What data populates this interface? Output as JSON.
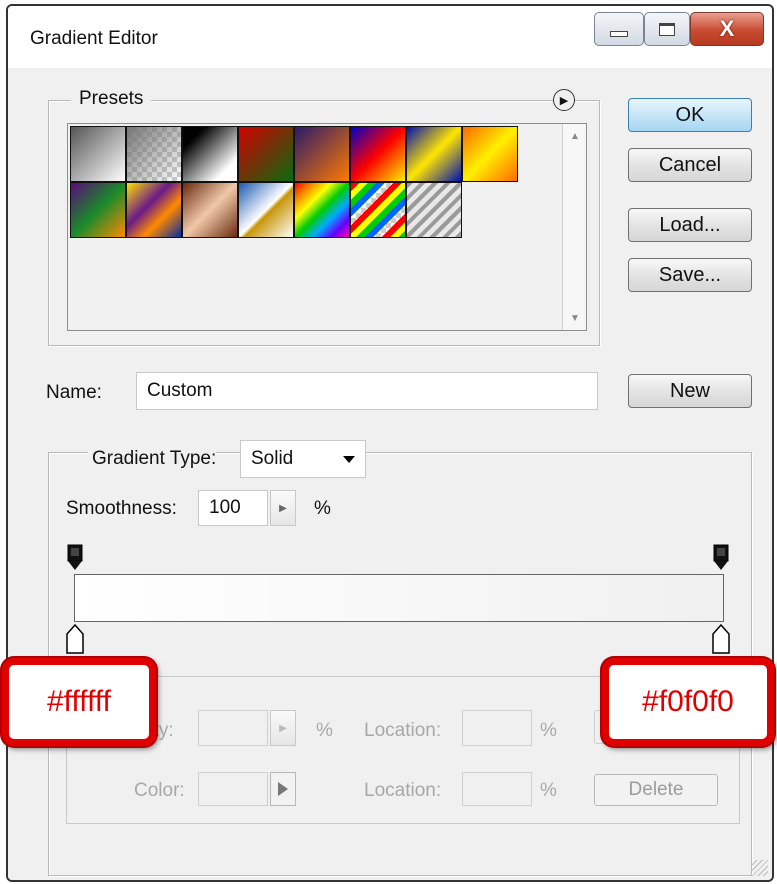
{
  "window": {
    "title": "Gradient Editor",
    "close_glyph": "X"
  },
  "presets": {
    "label": "Presets",
    "swatches": [
      {
        "name": "foreground-to-background",
        "css": "linear-gradient(135deg,#555,#fff)"
      },
      {
        "name": "foreground-to-transparent",
        "css": "linear-gradient(135deg,#777,rgba(255,255,255,0)),repeating-conic-gradient(#ccc 0 25%,#fff 0 50%) 0 0/10px 10px"
      },
      {
        "name": "black-white",
        "css": "linear-gradient(135deg,#000 20%,#fff 80%)"
      },
      {
        "name": "red-green",
        "css": "linear-gradient(135deg,#d10000,#0a6a10)"
      },
      {
        "name": "violet-orange",
        "css": "linear-gradient(135deg,#2a1a6a,#ff7a00)"
      },
      {
        "name": "blue-red-yellow",
        "css": "linear-gradient(135deg,#0000c8,#ff0000 50%,#ffee00)"
      },
      {
        "name": "blue-yellow-blue",
        "css": "linear-gradient(135deg,#0010b0,#ffe600 50%,#0010b0)"
      },
      {
        "name": "orange-yellow-orange",
        "css": "linear-gradient(135deg,#ff6a00,#fff000 50%,#ff6a00)"
      },
      {
        "name": "violet-green-orange",
        "css": "linear-gradient(135deg,#5a0a7a,#1a8a2a 50%,#ff8a00)"
      },
      {
        "name": "yellow-violet-orange-blue",
        "css": "linear-gradient(135deg,#ffe000,#6a1a8a 40%,#ff8a00 65%,#0a2aa0)"
      },
      {
        "name": "copper",
        "css": "linear-gradient(135deg,#6a2a10,#f0c8a8 50%,#6a2a10)"
      },
      {
        "name": "chrome",
        "css": "linear-gradient(135deg,#1a5ab0,#ffffff 50%,#c8960a 55%,#fff)"
      },
      {
        "name": "spectrum",
        "css": "linear-gradient(135deg,#ff0000,#ff8800,#ffff00,#00cc00,#00aaff,#6600ff,#ff00aa)"
      },
      {
        "name": "transparent-rainbow",
        "css": "repeating-linear-gradient(135deg,#ff0000 0 6px,#ffff00 6px 12px,#00cc00 12px 18px,#0066ff 18px 24px,transparent 24px 30px),repeating-conic-gradient(#ccc 0 25%,#fff 0 50%) 0 0/10px 10px"
      },
      {
        "name": "transparent-stripes",
        "css": "repeating-linear-gradient(135deg,#9a9a9a 0 4px,#e8e8e8 4px 9px)"
      }
    ]
  },
  "buttons": {
    "ok": "OK",
    "cancel": "Cancel",
    "load": "Load...",
    "save": "Save...",
    "new": "New",
    "delete": "Delete"
  },
  "name": {
    "label": "Name:",
    "value": "Custom"
  },
  "gradient": {
    "type_label": "Gradient Type:",
    "type_value": "Solid",
    "smoothness_label": "Smoothness:",
    "smoothness_value": "100",
    "percent": "%",
    "start_color": "#ffffff",
    "end_color": "#f0f0f0"
  },
  "stops": {
    "opacity_label": "Opacity:",
    "color_label": "Color:",
    "location_label": "Location:",
    "percent": "%"
  },
  "callouts": {
    "left": "#ffffff",
    "right": "#f0f0f0"
  }
}
